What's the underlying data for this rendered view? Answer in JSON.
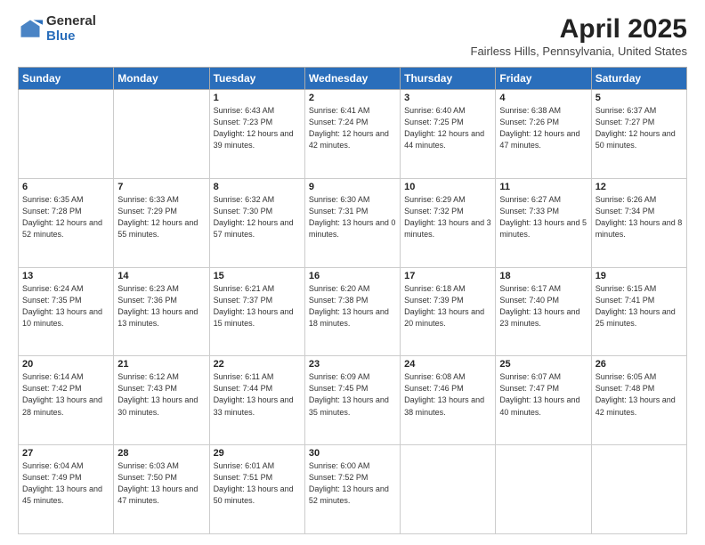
{
  "logo": {
    "general": "General",
    "blue": "Blue"
  },
  "title": {
    "month": "April 2025",
    "location": "Fairless Hills, Pennsylvania, United States"
  },
  "weekdays": [
    "Sunday",
    "Monday",
    "Tuesday",
    "Wednesday",
    "Thursday",
    "Friday",
    "Saturday"
  ],
  "weeks": [
    [
      {
        "day": "",
        "info": ""
      },
      {
        "day": "",
        "info": ""
      },
      {
        "day": "1",
        "info": "Sunrise: 6:43 AM\nSunset: 7:23 PM\nDaylight: 12 hours and 39 minutes."
      },
      {
        "day": "2",
        "info": "Sunrise: 6:41 AM\nSunset: 7:24 PM\nDaylight: 12 hours and 42 minutes."
      },
      {
        "day": "3",
        "info": "Sunrise: 6:40 AM\nSunset: 7:25 PM\nDaylight: 12 hours and 44 minutes."
      },
      {
        "day": "4",
        "info": "Sunrise: 6:38 AM\nSunset: 7:26 PM\nDaylight: 12 hours and 47 minutes."
      },
      {
        "day": "5",
        "info": "Sunrise: 6:37 AM\nSunset: 7:27 PM\nDaylight: 12 hours and 50 minutes."
      }
    ],
    [
      {
        "day": "6",
        "info": "Sunrise: 6:35 AM\nSunset: 7:28 PM\nDaylight: 12 hours and 52 minutes."
      },
      {
        "day": "7",
        "info": "Sunrise: 6:33 AM\nSunset: 7:29 PM\nDaylight: 12 hours and 55 minutes."
      },
      {
        "day": "8",
        "info": "Sunrise: 6:32 AM\nSunset: 7:30 PM\nDaylight: 12 hours and 57 minutes."
      },
      {
        "day": "9",
        "info": "Sunrise: 6:30 AM\nSunset: 7:31 PM\nDaylight: 13 hours and 0 minutes."
      },
      {
        "day": "10",
        "info": "Sunrise: 6:29 AM\nSunset: 7:32 PM\nDaylight: 13 hours and 3 minutes."
      },
      {
        "day": "11",
        "info": "Sunrise: 6:27 AM\nSunset: 7:33 PM\nDaylight: 13 hours and 5 minutes."
      },
      {
        "day": "12",
        "info": "Sunrise: 6:26 AM\nSunset: 7:34 PM\nDaylight: 13 hours and 8 minutes."
      }
    ],
    [
      {
        "day": "13",
        "info": "Sunrise: 6:24 AM\nSunset: 7:35 PM\nDaylight: 13 hours and 10 minutes."
      },
      {
        "day": "14",
        "info": "Sunrise: 6:23 AM\nSunset: 7:36 PM\nDaylight: 13 hours and 13 minutes."
      },
      {
        "day": "15",
        "info": "Sunrise: 6:21 AM\nSunset: 7:37 PM\nDaylight: 13 hours and 15 minutes."
      },
      {
        "day": "16",
        "info": "Sunrise: 6:20 AM\nSunset: 7:38 PM\nDaylight: 13 hours and 18 minutes."
      },
      {
        "day": "17",
        "info": "Sunrise: 6:18 AM\nSunset: 7:39 PM\nDaylight: 13 hours and 20 minutes."
      },
      {
        "day": "18",
        "info": "Sunrise: 6:17 AM\nSunset: 7:40 PM\nDaylight: 13 hours and 23 minutes."
      },
      {
        "day": "19",
        "info": "Sunrise: 6:15 AM\nSunset: 7:41 PM\nDaylight: 13 hours and 25 minutes."
      }
    ],
    [
      {
        "day": "20",
        "info": "Sunrise: 6:14 AM\nSunset: 7:42 PM\nDaylight: 13 hours and 28 minutes."
      },
      {
        "day": "21",
        "info": "Sunrise: 6:12 AM\nSunset: 7:43 PM\nDaylight: 13 hours and 30 minutes."
      },
      {
        "day": "22",
        "info": "Sunrise: 6:11 AM\nSunset: 7:44 PM\nDaylight: 13 hours and 33 minutes."
      },
      {
        "day": "23",
        "info": "Sunrise: 6:09 AM\nSunset: 7:45 PM\nDaylight: 13 hours and 35 minutes."
      },
      {
        "day": "24",
        "info": "Sunrise: 6:08 AM\nSunset: 7:46 PM\nDaylight: 13 hours and 38 minutes."
      },
      {
        "day": "25",
        "info": "Sunrise: 6:07 AM\nSunset: 7:47 PM\nDaylight: 13 hours and 40 minutes."
      },
      {
        "day": "26",
        "info": "Sunrise: 6:05 AM\nSunset: 7:48 PM\nDaylight: 13 hours and 42 minutes."
      }
    ],
    [
      {
        "day": "27",
        "info": "Sunrise: 6:04 AM\nSunset: 7:49 PM\nDaylight: 13 hours and 45 minutes."
      },
      {
        "day": "28",
        "info": "Sunrise: 6:03 AM\nSunset: 7:50 PM\nDaylight: 13 hours and 47 minutes."
      },
      {
        "day": "29",
        "info": "Sunrise: 6:01 AM\nSunset: 7:51 PM\nDaylight: 13 hours and 50 minutes."
      },
      {
        "day": "30",
        "info": "Sunrise: 6:00 AM\nSunset: 7:52 PM\nDaylight: 13 hours and 52 minutes."
      },
      {
        "day": "",
        "info": ""
      },
      {
        "day": "",
        "info": ""
      },
      {
        "day": "",
        "info": ""
      }
    ]
  ]
}
